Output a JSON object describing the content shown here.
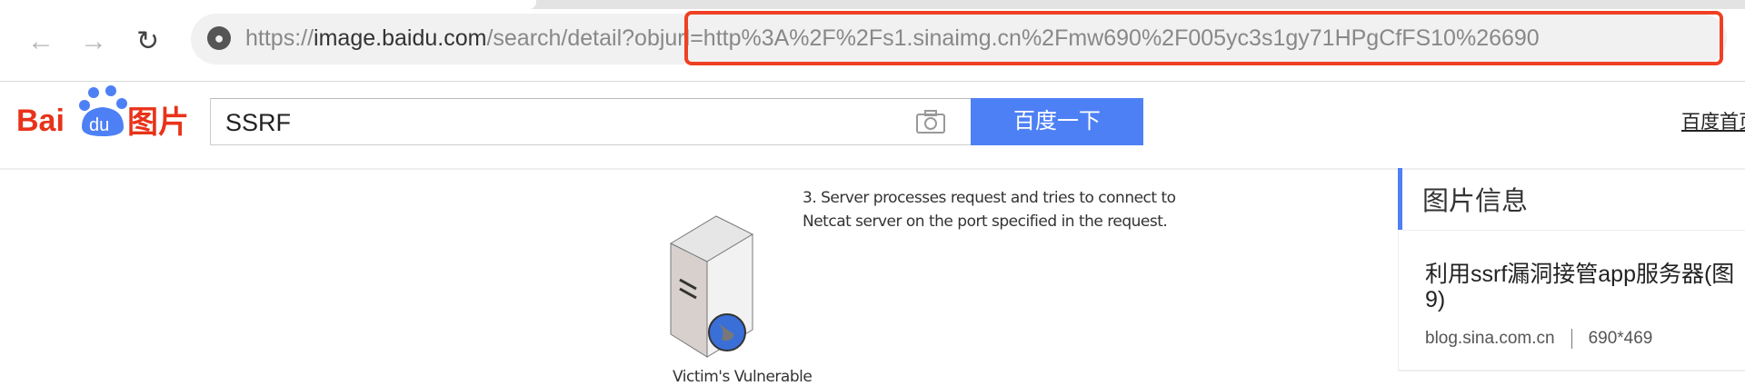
{
  "browser": {
    "url_prefix": "https://",
    "url_host": "image.baidu.com",
    "url_path": "/search/detail",
    "url_query": "?objurl=http%3A%2F%2Fs1.sinaimg.cn%2Fmw690%2F005yc3s1gy71HPgCfFS10%26690",
    "highlight_color": "#ef4023"
  },
  "header": {
    "logo_text": "Bai du 图片",
    "search_value": "SSRF",
    "search_button": "百度一下",
    "home_link": "百度首页",
    "accent": "#4e80f5"
  },
  "image": {
    "caption_line1": "3. Server processes request and tries to connect to",
    "caption_line2": "Netcat server on the port specified in the request.",
    "label": "Victim's Vulnerable"
  },
  "info": {
    "title": "图片信息",
    "name_line1": "利用ssrf漏洞接管app服务器(图",
    "name_line2": "9)",
    "source": "blog.sina.com.cn",
    "size": "690*469"
  }
}
